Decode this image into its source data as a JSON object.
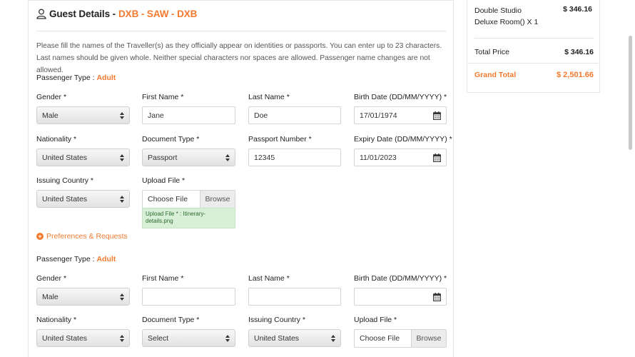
{
  "guest": {
    "title": "Guest Details -",
    "route": "DXB - SAW - DXB",
    "info": "Please fill the names of the Traveller(s) as they officially appear on identities or passports. You can enter up to 23 characters. Last names should be given whole. Neither special characters nor spaces are allowed. Passenger name changes are not allowed."
  },
  "labels": {
    "passenger_type": "Passenger Type :",
    "gender": "Gender *",
    "first_name": "First Name *",
    "last_name": "Last Name *",
    "birth_date": "Birth Date (DD/MM/YYYY) *",
    "nationality": "Nationality *",
    "document_type": "Document Type *",
    "passport_number": "Passport Number *",
    "expiry_date": "Expiry Date (DD/MM/YYYY) *",
    "issuing_country": "Issuing Country *",
    "upload_file": "Upload File *",
    "choose_file": "Choose File",
    "browse": "Browse"
  },
  "passenger1": {
    "type": "Adult",
    "gender": "Male",
    "first_name": "Jane",
    "last_name": "Doe",
    "birth_date": "17/01/1974",
    "nationality": "United States",
    "document_type": "Passport",
    "passport_number": "12345",
    "expiry_date": "11/01/2023",
    "issuing_country": "United States",
    "upload_note": "Upload File * : Itinerary-details.png"
  },
  "preferences_label": "Preferences & Requests",
  "passenger2": {
    "type": "Adult",
    "gender": "Male",
    "first_name": "",
    "last_name": "",
    "birth_date": "",
    "nationality": "United States",
    "document_type": "Select",
    "issuing_country": "United States"
  },
  "summary": {
    "room": "Double Studio Deluxe Room() X 1",
    "room_price": "$ 346.16",
    "total_label": "Total Price",
    "total_value": "$ 346.16",
    "grand_label": "Grand Total",
    "grand_value": "$ 2,501.66"
  },
  "colors": {
    "accent": "#f27a2f",
    "success_bg": "#d8efd8"
  }
}
